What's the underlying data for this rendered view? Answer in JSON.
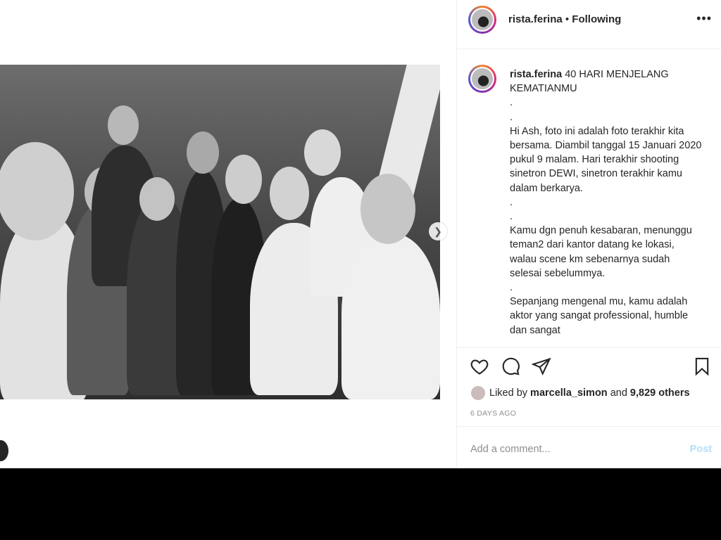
{
  "header": {
    "username": "rista.ferina",
    "separator": " • ",
    "follow_status": "Following",
    "more_icon": "more-horizontal-icon"
  },
  "post": {
    "image_icon": "photo",
    "next_icon": "chevron-right-icon"
  },
  "caption": {
    "username": "rista.ferina",
    "lines": [
      "40 HARI MENJELANG KEMATIANMU",
      ".",
      ".",
      "Hi Ash, foto ini adalah foto terakhir kita bersama. Diambil tanggal 15 Januari 2020 pukul 9 malam. Hari terakhir shooting sinetron DEWI, sinetron terakhir kamu dalam berkarya.",
      ".",
      ".",
      "Kamu dgn penuh kesabaran, menunggu teman2 dari kantor datang ke lokasi, walau scene km sebenarnya sudah selesai sebelummya.",
      ".",
      "Sepanjang mengenal mu, kamu adalah aktor yang sangat professional, humble dan sangat"
    ]
  },
  "actions": {
    "like_icon": "heart-icon",
    "comment_icon": "comment-icon",
    "share_icon": "share-icon",
    "save_icon": "bookmark-icon"
  },
  "likes": {
    "prefix": "Liked by ",
    "user": "marcella_simon",
    "middle": " and ",
    "count": "9,829 others"
  },
  "time_ago": "6 DAYS AGO",
  "comment": {
    "placeholder": "Add a comment...",
    "post_label": "Post"
  }
}
